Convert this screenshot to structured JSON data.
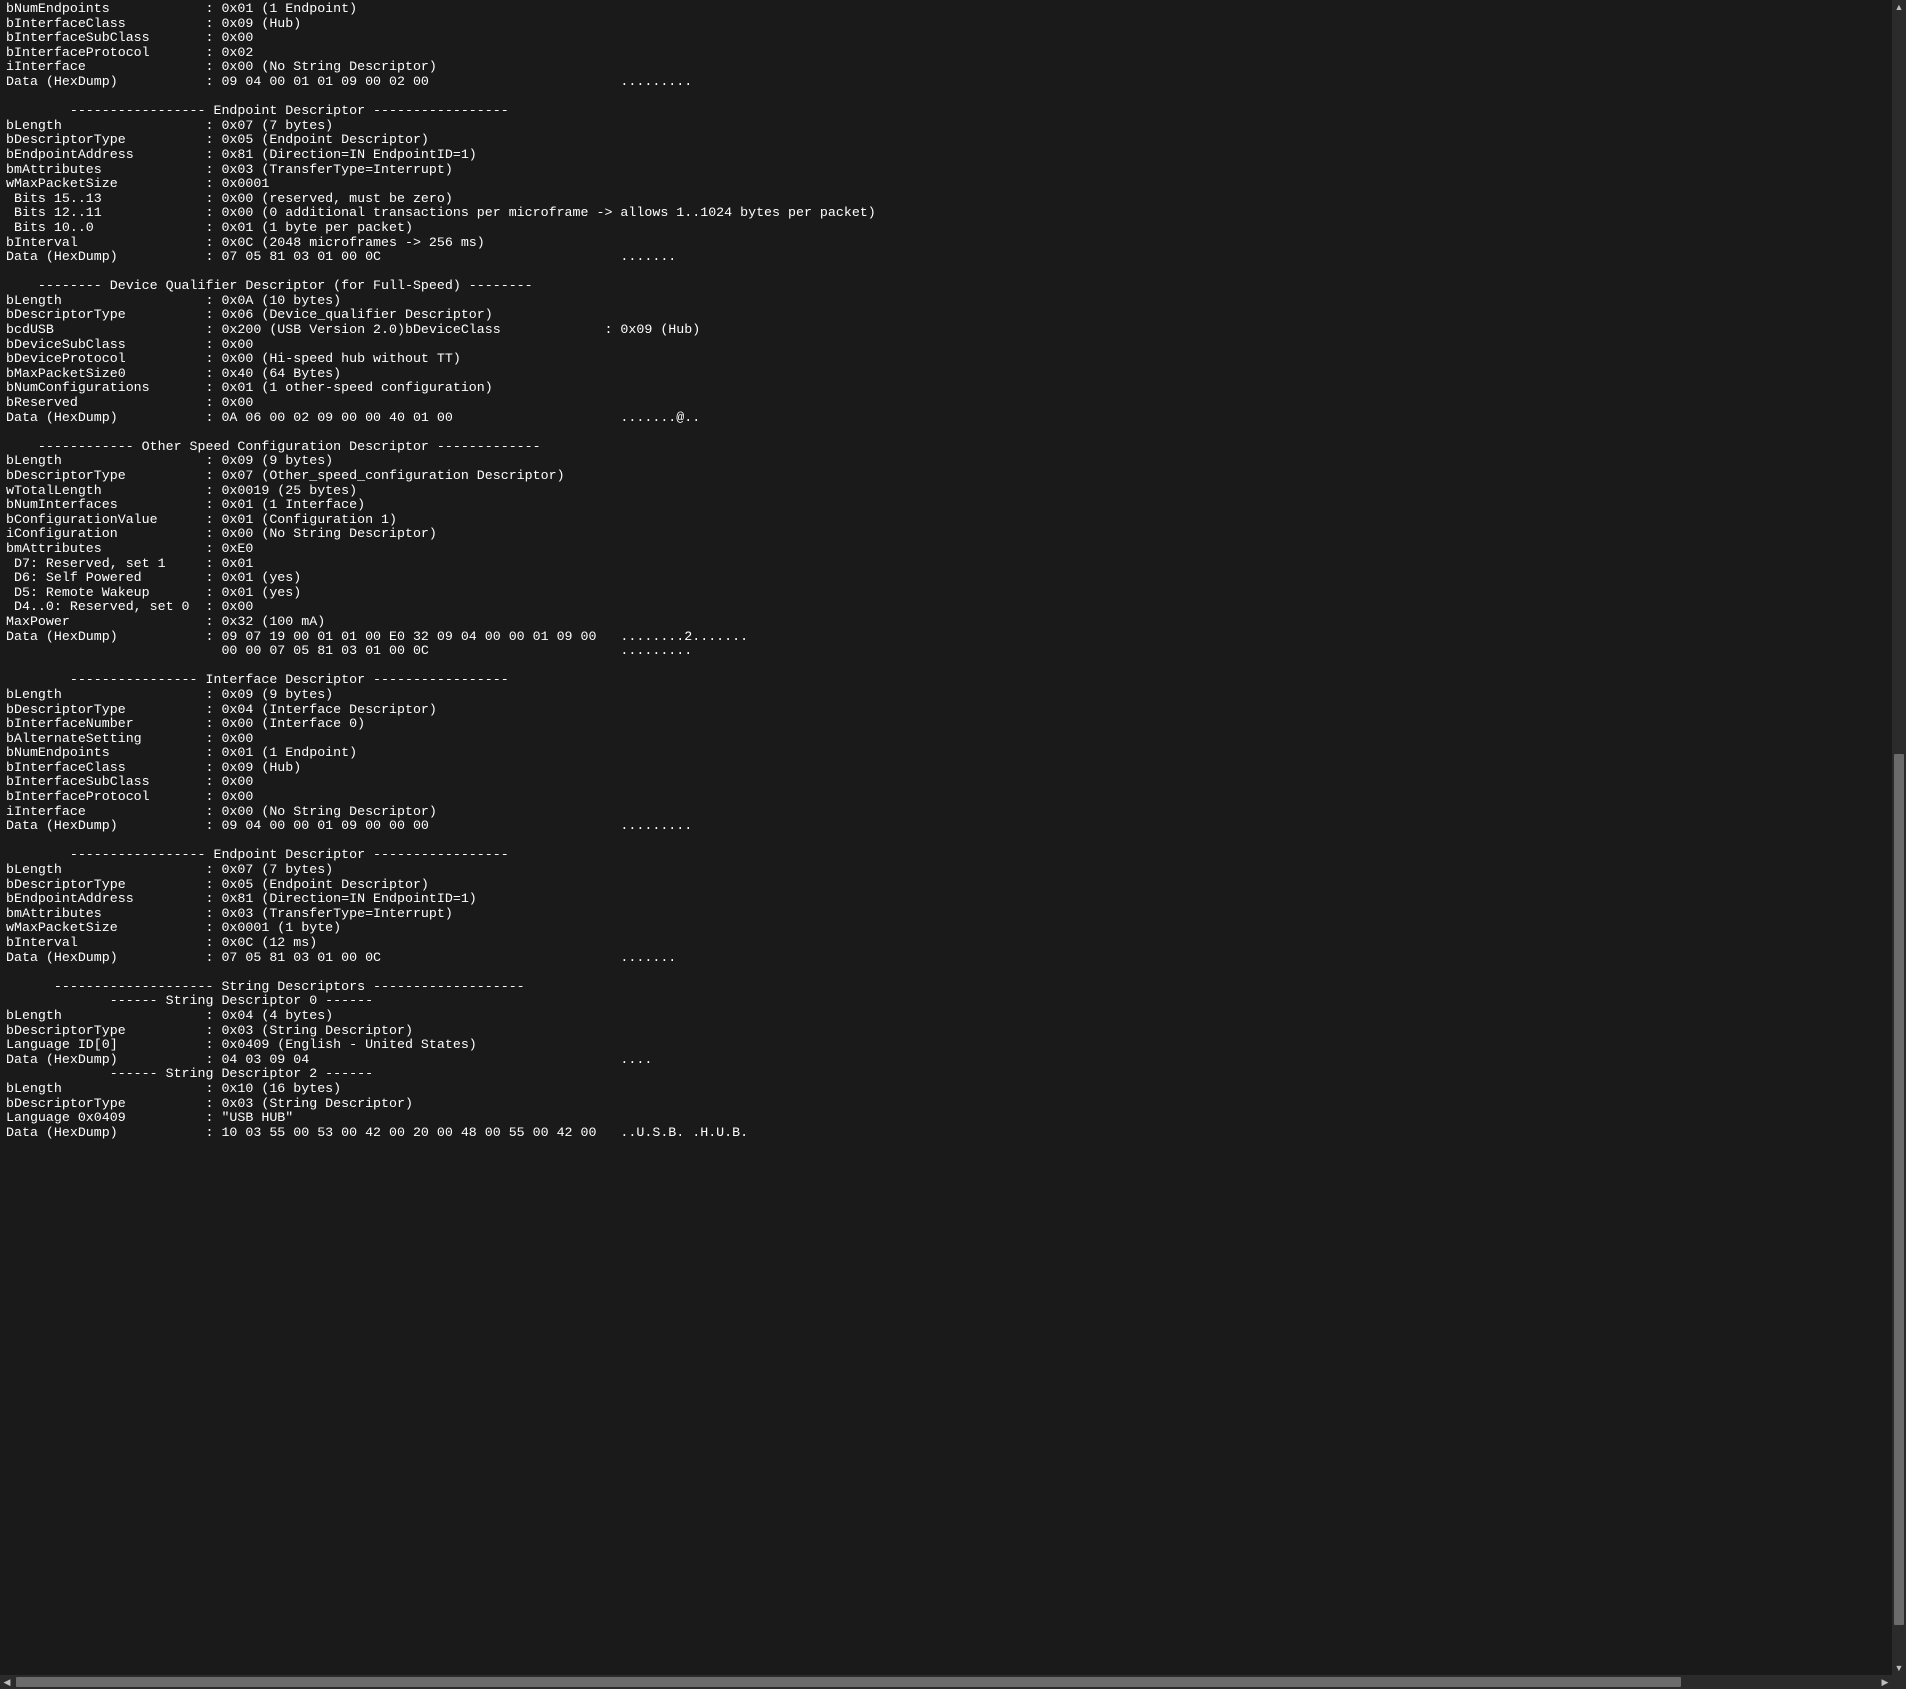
{
  "colors": {
    "bg": "#1a1a1a",
    "fg": "#ffffff",
    "scroll_track": "#2b2b2b",
    "scroll_thumb": "#6b6b6b"
  },
  "lines": [
    "bNumEndpoints            : 0x01 (1 Endpoint)",
    "bInterfaceClass          : 0x09 (Hub)",
    "bInterfaceSubClass       : 0x00",
    "bInterfaceProtocol       : 0x02",
    "iInterface               : 0x00 (No String Descriptor)",
    "Data (HexDump)           : 09 04 00 01 01 09 00 02 00                        .........",
    "",
    "        ----------------- Endpoint Descriptor -----------------",
    "bLength                  : 0x07 (7 bytes)",
    "bDescriptorType          : 0x05 (Endpoint Descriptor)",
    "bEndpointAddress         : 0x81 (Direction=IN EndpointID=1)",
    "bmAttributes             : 0x03 (TransferType=Interrupt)",
    "wMaxPacketSize           : 0x0001",
    " Bits 15..13             : 0x00 (reserved, must be zero)",
    " Bits 12..11             : 0x00 (0 additional transactions per microframe -> allows 1..1024 bytes per packet)",
    " Bits 10..0              : 0x01 (1 byte per packet)",
    "bInterval                : 0x0C (2048 microframes -> 256 ms)",
    "Data (HexDump)           : 07 05 81 03 01 00 0C                              .......",
    "",
    "    -------- Device Qualifier Descriptor (for Full-Speed) --------",
    "bLength                  : 0x0A (10 bytes)",
    "bDescriptorType          : 0x06 (Device_qualifier Descriptor)",
    "bcdUSB                   : 0x200 (USB Version 2.0)bDeviceClass             : 0x09 (Hub)",
    "bDeviceSubClass          : 0x00",
    "bDeviceProtocol          : 0x00 (Hi-speed hub without TT)",
    "bMaxPacketSize0          : 0x40 (64 Bytes)",
    "bNumConfigurations       : 0x01 (1 other-speed configuration)",
    "bReserved                : 0x00",
    "Data (HexDump)           : 0A 06 00 02 09 00 00 40 01 00                     .......@..",
    "",
    "    ------------ Other Speed Configuration Descriptor -------------",
    "bLength                  : 0x09 (9 bytes)",
    "bDescriptorType          : 0x07 (Other_speed_configuration Descriptor)",
    "wTotalLength             : 0x0019 (25 bytes)",
    "bNumInterfaces           : 0x01 (1 Interface)",
    "bConfigurationValue      : 0x01 (Configuration 1)",
    "iConfiguration           : 0x00 (No String Descriptor)",
    "bmAttributes             : 0xE0",
    " D7: Reserved, set 1     : 0x01",
    " D6: Self Powered        : 0x01 (yes)",
    " D5: Remote Wakeup       : 0x01 (yes)",
    " D4..0: Reserved, set 0  : 0x00",
    "MaxPower                 : 0x32 (100 mA)",
    "Data (HexDump)           : 09 07 19 00 01 01 00 E0 32 09 04 00 00 01 09 00   ........2.......",
    "                           00 00 07 05 81 03 01 00 0C                        .........",
    "",
    "        ---------------- Interface Descriptor -----------------",
    "bLength                  : 0x09 (9 bytes)",
    "bDescriptorType          : 0x04 (Interface Descriptor)",
    "bInterfaceNumber         : 0x00 (Interface 0)",
    "bAlternateSetting        : 0x00",
    "bNumEndpoints            : 0x01 (1 Endpoint)",
    "bInterfaceClass          : 0x09 (Hub)",
    "bInterfaceSubClass       : 0x00",
    "bInterfaceProtocol       : 0x00",
    "iInterface               : 0x00 (No String Descriptor)",
    "Data (HexDump)           : 09 04 00 00 01 09 00 00 00                        .........",
    "",
    "        ----------------- Endpoint Descriptor -----------------",
    "bLength                  : 0x07 (7 bytes)",
    "bDescriptorType          : 0x05 (Endpoint Descriptor)",
    "bEndpointAddress         : 0x81 (Direction=IN EndpointID=1)",
    "bmAttributes             : 0x03 (TransferType=Interrupt)",
    "wMaxPacketSize           : 0x0001 (1 byte)",
    "bInterval                : 0x0C (12 ms)",
    "Data (HexDump)           : 07 05 81 03 01 00 0C                              .......",
    "",
    "      -------------------- String Descriptors -------------------",
    "             ------ String Descriptor 0 ------",
    "bLength                  : 0x04 (4 bytes)",
    "bDescriptorType          : 0x03 (String Descriptor)",
    "Language ID[0]           : 0x0409 (English - United States)",
    "Data (HexDump)           : 04 03 09 04                                       ....",
    "             ------ String Descriptor 2 ------",
    "bLength                  : 0x10 (16 bytes)",
    "bDescriptorType          : 0x03 (String Descriptor)",
    "Language 0x0409          : \"USB HUB\"",
    "Data (HexDump)           : 10 03 55 00 53 00 42 00 20 00 48 00 55 00 42 00   ..U.S.B. .H.U.B."
  ]
}
